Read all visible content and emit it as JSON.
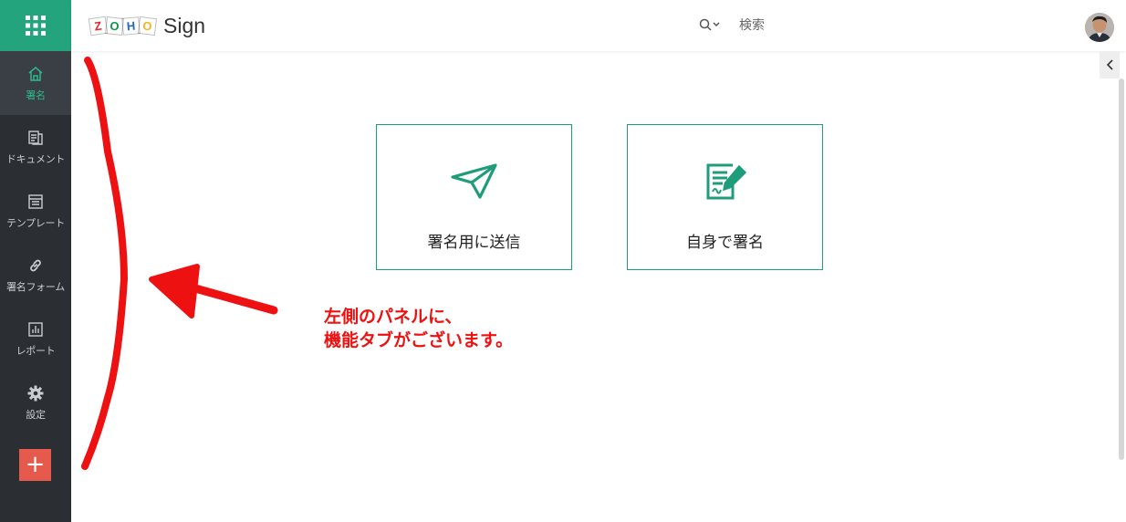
{
  "app": {
    "logo_letters": [
      "Z",
      "O",
      "H",
      "O"
    ],
    "logo_colors": [
      "#e42527",
      "#089949",
      "#226db4",
      "#f9b21d"
    ],
    "name": "Sign"
  },
  "header": {
    "search_placeholder": "検索"
  },
  "sidebar": {
    "items": [
      {
        "label": "署名",
        "icon": "home-icon",
        "active": true
      },
      {
        "label": "ドキュメント",
        "icon": "documents-icon",
        "active": false
      },
      {
        "label": "テンプレート",
        "icon": "template-icon",
        "active": false
      },
      {
        "label": "署名フォーム",
        "icon": "link-icon",
        "active": false
      },
      {
        "label": "レポート",
        "icon": "report-icon",
        "active": false
      },
      {
        "label": "設定",
        "icon": "gear-icon",
        "active": false
      }
    ],
    "add_label": "+"
  },
  "main": {
    "cards": [
      {
        "label": "署名用に送信",
        "icon": "paper-plane-icon"
      },
      {
        "label": "自身で署名",
        "icon": "sign-document-icon"
      }
    ]
  },
  "annotation": {
    "line1": "左側のパネルに、",
    "line2": "機能タブがございます。",
    "color": "#ee1111"
  },
  "colors": {
    "accent": "#23a47c",
    "sidebar_bg": "#2b2e33",
    "add_button": "#e65a4d"
  }
}
